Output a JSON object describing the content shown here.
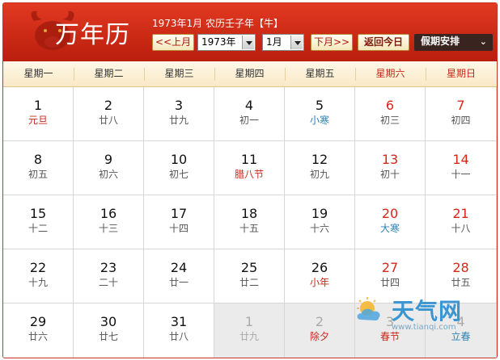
{
  "header": {
    "logo_text": "万年历",
    "date_text": "1973年1月 农历壬子年【牛】",
    "prev_month": "<<上月",
    "year_value": "1973年",
    "month_value": "1月",
    "next_month": "下月>>",
    "today_button": "返回今日",
    "holiday_dropdown": "假期安排",
    "holiday_chevron": "⌄"
  },
  "weekdays": [
    "星期一",
    "星期二",
    "星期三",
    "星期四",
    "星期五",
    "星期六",
    "星期日"
  ],
  "days": [
    {
      "num": "1",
      "lunar": "元旦",
      "kind": "festival"
    },
    {
      "num": "2",
      "lunar": "廿八"
    },
    {
      "num": "3",
      "lunar": "廿九"
    },
    {
      "num": "4",
      "lunar": "初一"
    },
    {
      "num": "5",
      "lunar": "小寒",
      "kind": "term"
    },
    {
      "num": "6",
      "lunar": "初三"
    },
    {
      "num": "7",
      "lunar": "初四"
    },
    {
      "num": "8",
      "lunar": "初五"
    },
    {
      "num": "9",
      "lunar": "初六"
    },
    {
      "num": "10",
      "lunar": "初七"
    },
    {
      "num": "11",
      "lunar": "腊八节",
      "kind": "festival"
    },
    {
      "num": "12",
      "lunar": "初九"
    },
    {
      "num": "13",
      "lunar": "初十"
    },
    {
      "num": "14",
      "lunar": "十一"
    },
    {
      "num": "15",
      "lunar": "十二"
    },
    {
      "num": "16",
      "lunar": "十三"
    },
    {
      "num": "17",
      "lunar": "十四"
    },
    {
      "num": "18",
      "lunar": "十五"
    },
    {
      "num": "19",
      "lunar": "十六"
    },
    {
      "num": "20",
      "lunar": "大寒",
      "kind": "term"
    },
    {
      "num": "21",
      "lunar": "十八"
    },
    {
      "num": "22",
      "lunar": "十九"
    },
    {
      "num": "23",
      "lunar": "二十"
    },
    {
      "num": "24",
      "lunar": "廿一"
    },
    {
      "num": "25",
      "lunar": "廿二"
    },
    {
      "num": "26",
      "lunar": "小年",
      "kind": "festival"
    },
    {
      "num": "27",
      "lunar": "廿四"
    },
    {
      "num": "28",
      "lunar": "廿五"
    },
    {
      "num": "29",
      "lunar": "廿六"
    },
    {
      "num": "30",
      "lunar": "廿七"
    },
    {
      "num": "31",
      "lunar": "廿八"
    },
    {
      "num": "1",
      "lunar": "廿九",
      "other": true
    },
    {
      "num": "2",
      "lunar": "除夕",
      "kind": "festival",
      "other": true
    },
    {
      "num": "3",
      "lunar": "春节",
      "kind": "festival",
      "other": true
    },
    {
      "num": "4",
      "lunar": "立春",
      "kind": "term",
      "other": true
    }
  ],
  "watermark": {
    "brand": "天气网",
    "url": "www.tianqi.com"
  },
  "colors": {
    "header_red": "#cc2a16",
    "weekend_red": "#d9261a",
    "solar_term_blue": "#2e82b8"
  }
}
